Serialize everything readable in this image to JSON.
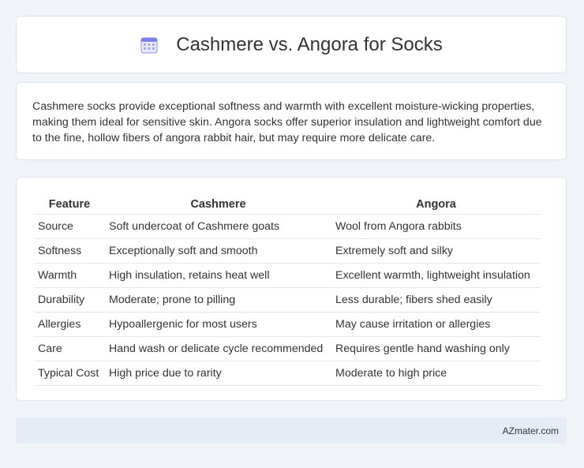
{
  "header": {
    "title": "Cashmere vs. Angora for Socks",
    "icon": "calendar-icon",
    "icon_color": "#6f74e8"
  },
  "description": "Cashmere socks provide exceptional softness and warmth with excellent moisture-wicking properties, making them ideal for sensitive skin. Angora socks offer superior insulation and lightweight comfort due to the fine, hollow fibers of angora rabbit hair, but may require more delicate care.",
  "table": {
    "headers": [
      "Feature",
      "Cashmere",
      "Angora"
    ],
    "rows": [
      [
        "Source",
        "Soft undercoat of Cashmere goats",
        "Wool from Angora rabbits"
      ],
      [
        "Softness",
        "Exceptionally soft and smooth",
        "Extremely soft and silky"
      ],
      [
        "Warmth",
        "High insulation, retains heat well",
        "Excellent warmth, lightweight insulation"
      ],
      [
        "Durability",
        "Moderate; prone to pilling",
        "Less durable; fibers shed easily"
      ],
      [
        "Allergies",
        "Hypoallergenic for most users",
        "May cause irritation or allergies"
      ],
      [
        "Care",
        "Hand wash or delicate cycle recommended",
        "Requires gentle hand washing only"
      ],
      [
        "Typical Cost",
        "High price due to rarity",
        "Moderate to high price"
      ]
    ]
  },
  "footer": {
    "site": "AZmater.com"
  }
}
